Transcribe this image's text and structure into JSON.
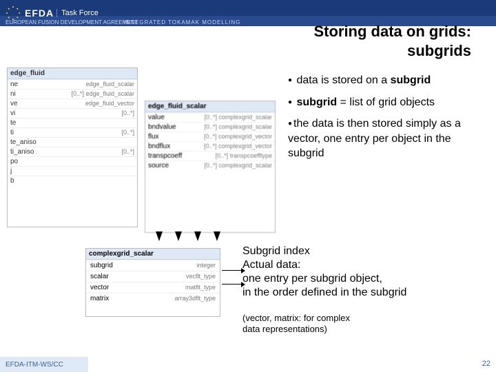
{
  "header": {
    "org": "EFDA",
    "taskforce": "Task Force",
    "sub1": "EUROPEAN FUSION DEVELOPMENT AGREEMENT",
    "sub2": "INTEGRATED TOKAMAK MODELLING"
  },
  "title": {
    "line1": "Storing data on grids:",
    "line2": "subgrids"
  },
  "bullets": {
    "b1a": "data is stored on a ",
    "b1b": "subgrid",
    "b2a": "subgrid",
    "b2b": " = list of grid objects",
    "b3": "the data is then stored simply as a vector, one entry per object in the subgrid"
  },
  "lower": {
    "l1": "Subgrid index",
    "l2": "Actual data:\none entry per subgrid object,\nin the order defined in the subgrid",
    "l3": "(vector, matrix: for complex\ndata representations)"
  },
  "tree1": {
    "header": "edge_fluid",
    "rows": [
      [
        "ne",
        "edge_fluid_scalar"
      ],
      [
        "ni",
        "[0..*]  edge_fluid_scalar"
      ],
      [
        "ve",
        "edge_fluid_vector"
      ],
      [
        "vi",
        "[0..*]"
      ],
      [
        "te",
        ""
      ],
      [
        "ti",
        "[0..*]"
      ],
      [
        "te_aniso",
        ""
      ],
      [
        "ti_aniso",
        "[0..*]"
      ],
      [
        "po",
        ""
      ],
      [
        "j",
        ""
      ],
      [
        "b",
        ""
      ]
    ]
  },
  "tree2": {
    "header": "edge_fluid_scalar",
    "rows": [
      [
        "value",
        "[0..*]  complexgrid_scalar"
      ],
      [
        "bndvalue",
        "[0..*]  complexgrid_scalar"
      ],
      [
        "flux",
        "[0..*]  complexgrid_vector"
      ],
      [
        "bndflux",
        "[0..*]  complexgrid_vector"
      ],
      [
        "transpcoeff",
        "[0..*]  transpcoefftype"
      ],
      [
        "source",
        "[0..*]  complexgrid_scalar"
      ]
    ]
  },
  "tree3": {
    "header": "complexgrid_scalar",
    "rows": [
      [
        "subgrid",
        "integer"
      ],
      [
        "scalar",
        "vecflt_type"
      ],
      [
        "vector",
        "matflt_type"
      ],
      [
        "matrix",
        "array3dflt_type"
      ]
    ]
  },
  "footer": {
    "code": "EFDA-ITM-WS/CC",
    "page": "22"
  }
}
